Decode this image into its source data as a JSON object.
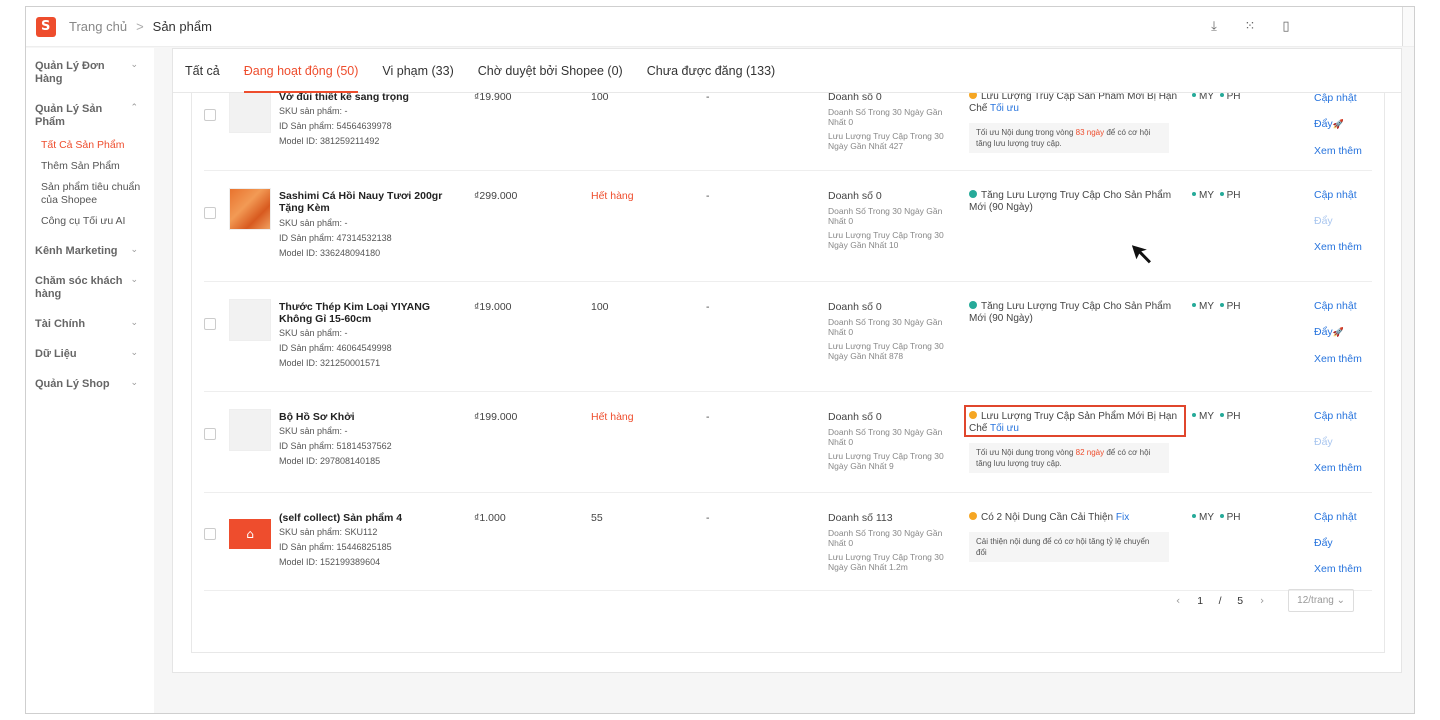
{
  "breadcrumb": {
    "home": "Trang chủ",
    "separator": ">",
    "current": "Sản phẩm"
  },
  "top_icons": [
    "download-icon",
    "apps-grid-icon",
    "book-icon"
  ],
  "sidebar": {
    "groups": [
      {
        "title": "Quản Lý Đơn Hàng",
        "chevron": "⌄"
      },
      {
        "title": "Quản Lý Sản Phẩm",
        "chevron": "⌃",
        "items": [
          {
            "label": "Tất Cả Sản Phẩm",
            "active": true
          },
          {
            "label": "Thêm Sản Phẩm"
          },
          {
            "label": "Sản phẩm tiêu chuẩn của Shopee"
          },
          {
            "label": "Công cụ Tối ưu AI"
          }
        ]
      },
      {
        "title": "Kênh Marketing",
        "chevron": "⌄"
      },
      {
        "title": "Chăm sóc khách hàng",
        "chevron": "⌄"
      },
      {
        "title": "Tài Chính",
        "chevron": "⌄"
      },
      {
        "title": "Dữ Liệu",
        "chevron": "⌄"
      },
      {
        "title": "Quản Lý Shop",
        "chevron": "⌄"
      }
    ]
  },
  "tabs": [
    {
      "label": "Tất cả"
    },
    {
      "label": "Đang hoạt động (50)",
      "active": true
    },
    {
      "label": "Vi phạm (33)"
    },
    {
      "label": "Chờ duyệt bởi Shopee (0)"
    },
    {
      "label": "Chưa được đăng (133)"
    }
  ],
  "products": [
    {
      "name": "Vớ đùi thiết kế sang trọng",
      "sku": "SKU sản phẩm: -",
      "id": "ID Sản phẩm: 54564639978",
      "model": "Model ID: 381259211492",
      "price": "₫19.900",
      "stock": "100",
      "dash": "-",
      "sales": "Doanh số 0",
      "sales_30": "Doanh Số Trong 30 Ngày Gần Nhất 0",
      "traffic_30": "Lưu Lượng Truy Cập Trong 30 Ngày Gần Nhất 427",
      "quality": "Lưu Lượng Truy Cập Sản Phẩm Mới Bị Hạn Chế",
      "quality_link": "Tối ưu",
      "tip_pre": "Tối ưu Nội dung trong vòng",
      "tip_days": "83 ngày",
      "tip_post": "để có cơ hội tăng lưu lượng truy cập.",
      "regions": [
        "MY",
        "PH"
      ],
      "actions": [
        "Cập nhật",
        "Đẩy",
        "Xem thêm"
      ]
    },
    {
      "name": "Sashimi Cá Hồi Nauy Tươi 200gr Tặng Kèm",
      "sku": "SKU sản phẩm: -",
      "id": "ID Sản phẩm: 47314532138",
      "model": "Model ID: 336248094180",
      "price": "₫299.000",
      "stock": "Hết hàng",
      "dash": "-",
      "sales": "Doanh số 0",
      "sales_30": "Doanh Số Trong 30 Ngày Gần Nhất 0",
      "traffic_30": "Lưu Lượng Truy Cập Trong 30 Ngày Gần Nhất 10",
      "quality": "Tăng Lưu Lượng Truy Cập Cho Sản Phẩm Mới (90 Ngày)",
      "regions": [
        "MY",
        "PH"
      ],
      "actions": [
        "Cập nhật",
        "Đẩy",
        "Xem thêm"
      ]
    },
    {
      "name": "Thước Thép Kim Loại YIYANG Không Gỉ 15-60cm",
      "sku": "SKU sản phẩm: -",
      "id": "ID Sản phẩm: 46064549998",
      "model": "Model ID: 321250001571",
      "price": "₫19.000",
      "stock": "100",
      "dash": "-",
      "sales": "Doanh số 0",
      "sales_30": "Doanh Số Trong 30 Ngày Gần Nhất 0",
      "traffic_30": "Lưu Lượng Truy Cập Trong 30 Ngày Gần Nhất 878",
      "quality": "Tăng Lưu Lượng Truy Cập Cho Sản Phẩm Mới (90 Ngày)",
      "regions": [
        "MY",
        "PH"
      ],
      "actions": [
        "Cập nhật",
        "Đẩy",
        "Xem thêm"
      ]
    },
    {
      "name": "Bộ Hồ Sơ Khởi",
      "sku": "SKU sản phẩm: -",
      "id": "ID Sản phẩm: 51814537562",
      "model": "Model ID: 297808140185",
      "price": "₫199.000",
      "stock": "Hết hàng",
      "dash": "-",
      "sales": "Doanh số 0",
      "sales_30": "Doanh Số Trong 30 Ngày Gần Nhất 0",
      "traffic_30": "Lưu Lượng Truy Cập Trong 30 Ngày Gần Nhất 9",
      "quality": "Lưu Lượng Truy Cập Sản Phẩm Mới Bị Hạn Chế",
      "quality_link": "Tối ưu",
      "tip_pre": "Tối ưu Nội dung trong vòng",
      "tip_days": "82 ngày",
      "tip_post": "để có cơ hội tăng lưu lượng truy cập.",
      "regions": [
        "MY",
        "PH"
      ],
      "actions": [
        "Cập nhật",
        "Đẩy",
        "Xem thêm"
      ]
    },
    {
      "name": "(self collect) Sản phẩm 4",
      "sku": "SKU sản phẩm: SKU112",
      "id": "ID Sản phẩm: 15446825185",
      "model": "Model ID: 152199389604",
      "price": "₫1.000",
      "stock": "55",
      "dash": "-",
      "sales": "Doanh số 113",
      "sales_30": "Doanh Số Trong 30 Ngày Gần Nhất 0",
      "traffic_30": "Lưu Lượng Truy Cập Trong 30 Ngày Gần Nhất 1.2m",
      "quality": "Có 2 Nội Dung Cần Cải Thiện",
      "quality_link": "Fix",
      "tip_text": "Cải thiện nội dung để có cơ hội tăng tỷ lệ chuyển đổi",
      "regions": [
        "MY",
        "PH"
      ],
      "actions": [
        "Cập nhật",
        "Đẩy",
        "Xem thêm"
      ]
    }
  ],
  "pagination": {
    "prev": "‹",
    "current": "1",
    "sep": "/",
    "total": "5",
    "next": "›",
    "page_size": "12/trang ⌄"
  }
}
